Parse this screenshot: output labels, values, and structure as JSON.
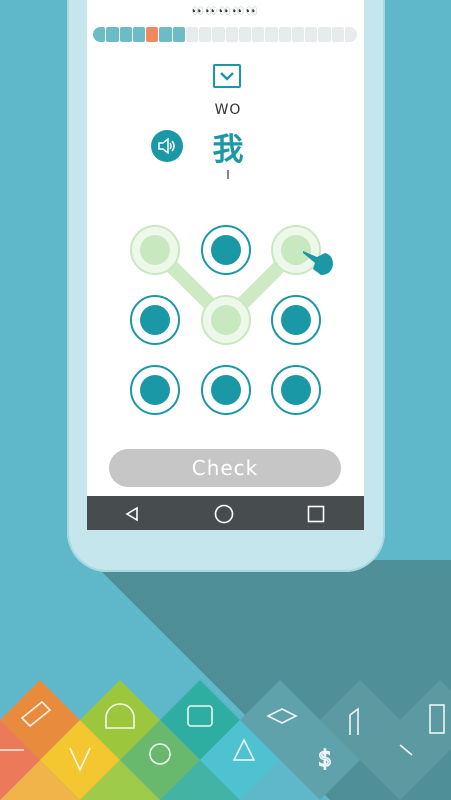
{
  "progress": {
    "decor_glyphs": "👀👀👀👀👀",
    "segments": [
      "done",
      "done",
      "done",
      "done",
      "current",
      "done",
      "done",
      "todo",
      "todo",
      "todo",
      "todo",
      "todo",
      "todo",
      "todo",
      "todo",
      "todo",
      "todo",
      "todo",
      "todo",
      "todo"
    ],
    "colors": {
      "done": "#6bbcc6",
      "current": "#f08a5d",
      "todo": "#e7ebec"
    }
  },
  "card": {
    "pinyin": "WO",
    "hanzi": "我",
    "meaning": "I"
  },
  "pattern": {
    "rows": 3,
    "cols": 3,
    "selected_nodes": [
      0,
      2,
      4
    ]
  },
  "actions": {
    "check_label": "Check"
  },
  "icons": {
    "collapse": "chevron-down-icon",
    "audio": "speaker-icon",
    "hand": "pointing-hand-icon",
    "back": "back-triangle-icon",
    "home": "home-circle-icon",
    "recent": "recent-square-icon"
  },
  "colors": {
    "accent": "#1a98a6",
    "background": "#5fb8c9",
    "selected": "#c8e8c0"
  }
}
